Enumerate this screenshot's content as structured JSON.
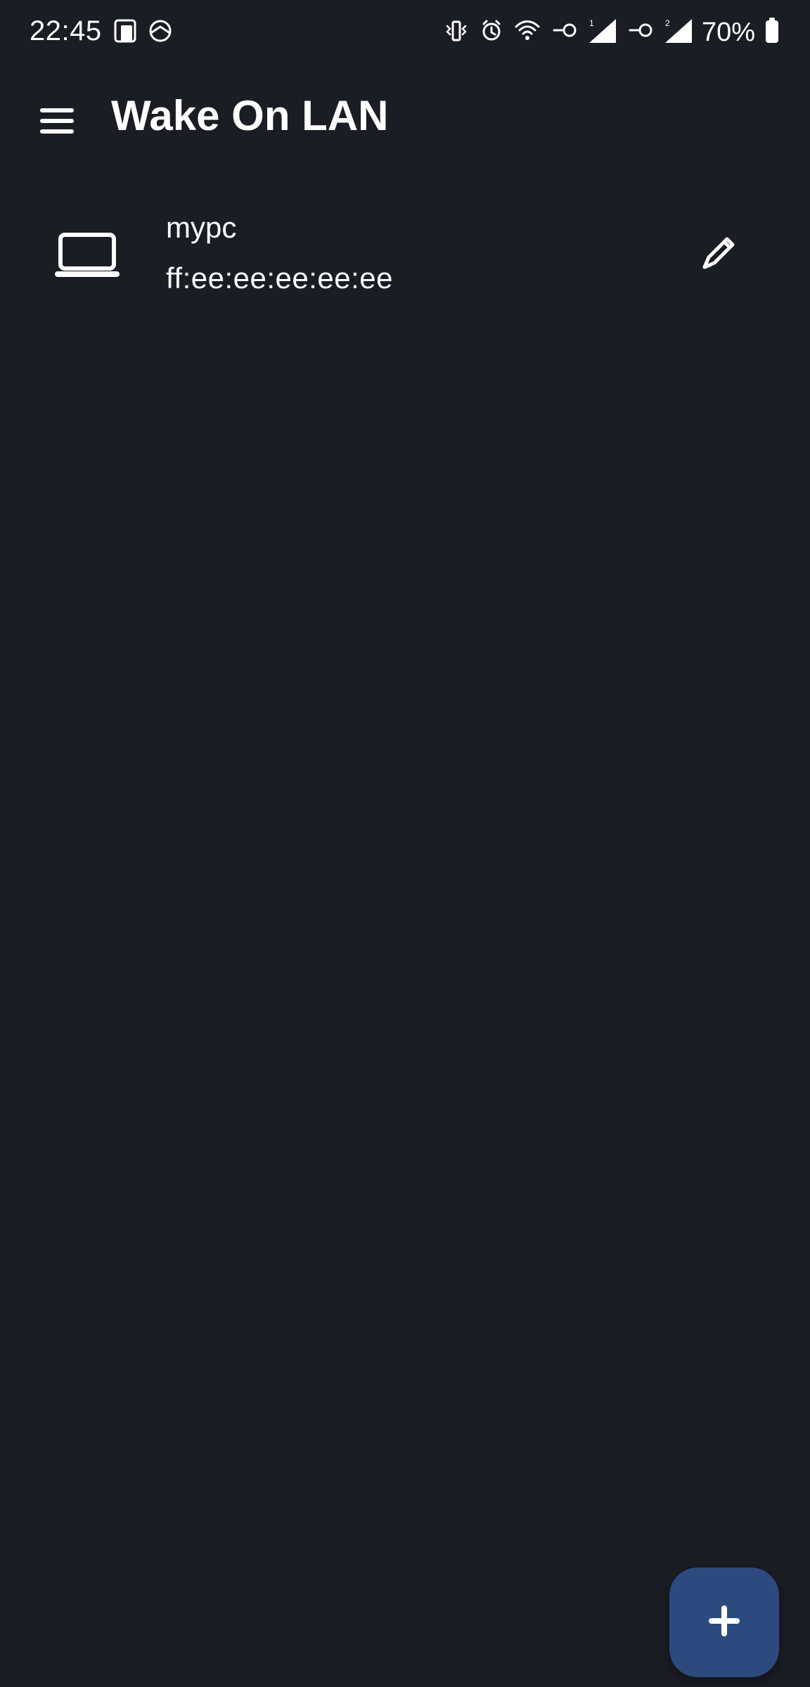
{
  "status_bar": {
    "time": "22:45",
    "battery_percent": "70%",
    "icons_left": [
      "screen-mirror-icon",
      "sync-icon"
    ],
    "icons_right": [
      "vibrate-icon",
      "alarm-icon",
      "wifi-icon",
      "lte-icon",
      "signal-icon-1",
      "lte-icon",
      "signal-icon-2",
      "battery-icon"
    ]
  },
  "app_bar": {
    "title": "Wake On LAN",
    "menu_icon": "hamburger-menu-icon"
  },
  "devices": [
    {
      "name": "mypc",
      "mac": "ff:ee:ee:ee:ee:ee",
      "icon": "laptop-icon",
      "action_icon": "edit-pencil-icon"
    }
  ],
  "fab": {
    "icon": "plus-icon"
  },
  "colors": {
    "background": "#1b1d24",
    "fab": "#2c4a7e",
    "text": "#ffffff"
  }
}
